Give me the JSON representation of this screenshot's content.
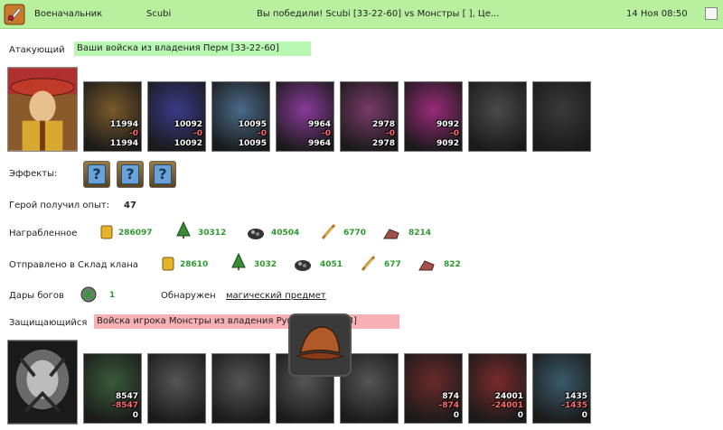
{
  "topbar": {
    "title": "Военачальник",
    "user": "Scubi",
    "message": "Вы победили! Scubi [33-22-60] vs Монстры [                  ], Це...",
    "datetime": "14 Ноя 08:50"
  },
  "attacker": {
    "label": "Атакующий",
    "name": "Ваши войска из владения Перм [33-22-60]",
    "units": [
      {
        "icon": "armored-beast-unit",
        "n1": "11994",
        "n2": "-0",
        "n3": "11994",
        "color": "#7a5a2a"
      },
      {
        "icon": "blue-mage-unit",
        "n1": "10092",
        "n2": "-0",
        "n3": "10092",
        "color": "#3a3a8a"
      },
      {
        "icon": "knight-unit",
        "n1": "10095",
        "n2": "-0",
        "n3": "10095",
        "color": "#4a6a8a"
      },
      {
        "icon": "winged-fairy-unit",
        "n1": "9964",
        "n2": "-0",
        "n3": "9964",
        "color": "#8a3a9a"
      },
      {
        "icon": "archer-unit",
        "n1": "2978",
        "n2": "-0",
        "n3": "2978",
        "color": "#7a3a6a"
      },
      {
        "icon": "priestess-unit",
        "n1": "9092",
        "n2": "-0",
        "n3": "9092",
        "color": "#9a2a7a"
      },
      {
        "icon": "shadow-warrior-unit",
        "n1": "",
        "n2": "",
        "n3": "",
        "color": "#4a4a4a"
      },
      {
        "icon": "dark-knight-unit",
        "n1": "",
        "n2": "",
        "n3": "",
        "color": "#3a3a3a"
      }
    ]
  },
  "effects": {
    "label": "Эффекты:"
  },
  "exp": {
    "label": "Герой получил опыт:",
    "value": "47"
  },
  "looted": {
    "label": "Награбленное",
    "values": [
      "286097",
      "30312",
      "40504",
      "6770",
      "8214"
    ]
  },
  "clan": {
    "label": "Отправлено в Склад клана",
    "values": [
      "28610",
      "3032",
      "4051",
      "677",
      "822"
    ]
  },
  "gifts": {
    "label": "Дары богов",
    "value": "1",
    "found_label": "Обнаружен",
    "found_link": "магический предмет"
  },
  "defender": {
    "label": "Защищающийся",
    "name": "Войска игрока Монстры из владения Руины [32-20-23]",
    "units": [
      {
        "icon": "monster-beast-unit",
        "n1": "8547",
        "n2": "-8547",
        "n3": "0",
        "color": "#3a5a3a"
      },
      {
        "icon": "empty-slot",
        "n1": "",
        "n2": "",
        "n3": "",
        "color": "#555"
      },
      {
        "icon": "empty-slot",
        "n1": "",
        "n2": "",
        "n3": "",
        "color": "#555"
      },
      {
        "icon": "empty-slot",
        "n1": "",
        "n2": "",
        "n3": "",
        "color": "#555"
      },
      {
        "icon": "empty-slot",
        "n1": "",
        "n2": "",
        "n3": "",
        "color": "#555"
      },
      {
        "icon": "red-demon-unit",
        "n1": "874",
        "n2": "-874",
        "n3": "0",
        "color": "#6a2a2a"
      },
      {
        "icon": "crimson-guardian-unit",
        "n1": "24001",
        "n2": "-24001",
        "n3": "0",
        "color": "#7a2a2a"
      },
      {
        "icon": "purple-dragon-unit",
        "n1": "1435",
        "n2": "-1435",
        "n3": "0",
        "color": "#3a5a6a"
      }
    ]
  }
}
